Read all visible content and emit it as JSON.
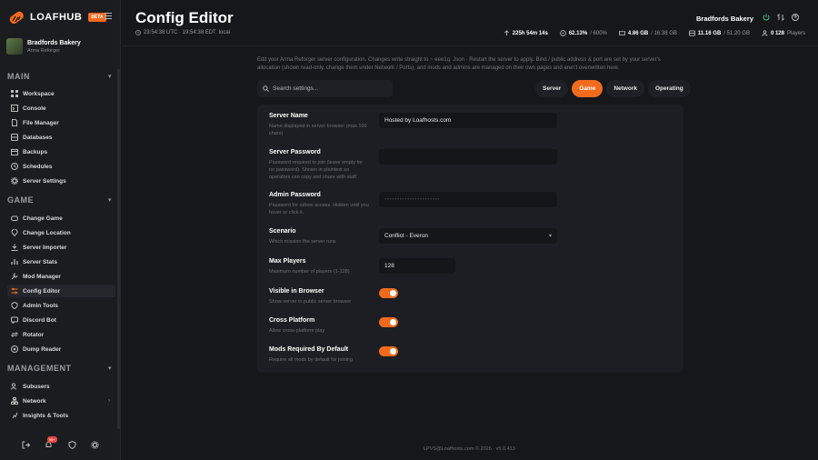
{
  "brand": {
    "name": "LOAFHUB",
    "badge": "BETA",
    "color": "#f26b1d"
  },
  "server": {
    "name": "Bradfords Bakery",
    "game": "Arma Reforger"
  },
  "sections": {
    "main": "MAIN",
    "game": "GAME",
    "management": "MANAGEMENT"
  },
  "nav": {
    "main": [
      "Workspace",
      "Console",
      "File Manager",
      "Databases",
      "Backups",
      "Schedules",
      "Server Settings"
    ],
    "game": [
      "Change Game",
      "Change Location",
      "Server Importer",
      "Server Stats",
      "Mod Manager",
      "Config Editor",
      "Admin Tools",
      "Discord Bot",
      "Rotator",
      "Dump Reader"
    ],
    "management": [
      "Subusers",
      "Network",
      "Insights & Tools"
    ]
  },
  "active_nav": "Config Editor",
  "notifications": {
    "count": "99+"
  },
  "header": {
    "title": "Config Editor",
    "clock": "23:54:38 UTC · 19:54:38 EDT",
    "clock_suffix": "local",
    "server_name": "Bradfords Bakery",
    "stats": [
      {
        "icon": "uptime-icon",
        "value": "225h 54m 14s",
        "extra": ""
      },
      {
        "icon": "cpu-icon",
        "value": "62.13%",
        "extra": "/ 600%"
      },
      {
        "icon": "memory-icon",
        "value": "4.86 GB",
        "extra": "/ 16.38 GB"
      },
      {
        "icon": "disk-icon",
        "value": "11.16 GB",
        "extra": "/ 51.20 GB"
      },
      {
        "icon": "players-icon",
        "value": "0 128",
        "extra": "Players"
      }
    ]
  },
  "description": "Edit your Arma Reforger server configuration. Changes write straight to ~ eee1q. Json · Restart the server to apply. Bind / public address & port are set by your server's allocation (shown read-only, change them under Network / Ports), and mods and admins are managed on their own pages and aren't overwritten here.",
  "search": {
    "placeholder": "Search settings..."
  },
  "tabs": [
    "Server",
    "Game",
    "Network",
    "Operating"
  ],
  "active_tab": "Game",
  "settings": {
    "server_name": {
      "label": "Server Name",
      "help": "Name displayed in server browser (max 100 chars)",
      "value": "Hosted by Loafhosts.com"
    },
    "server_password": {
      "label": "Server Password",
      "help": "Password required to join (leave empty for no password). Shown in plaintext so operators can copy and share with staff.",
      "value": ""
    },
    "admin_password": {
      "label": "Admin Password",
      "help": "Password for admin access. Hidden until you hover or click it.",
      "value": "••••••••••••••••••••••"
    },
    "scenario": {
      "label": "Scenario",
      "help": "Which mission the server runs",
      "value": "Conflict - Everon"
    },
    "max_players": {
      "label": "Max Players",
      "help": "Maximum number of players (1-128)",
      "value": "128"
    },
    "visible": {
      "label": "Visible in Browser",
      "help": "Show server in public server browser",
      "on": true
    },
    "crossplatform": {
      "label": "Cross Platform",
      "help": "Allow cross-platform play",
      "on": true
    },
    "mods_required": {
      "label": "Mods Required By Default",
      "help": "Require all mods by default for joining",
      "on": true
    }
  },
  "footer": "LPVS@Loafhosts.com © 2026 · v5.0.413"
}
